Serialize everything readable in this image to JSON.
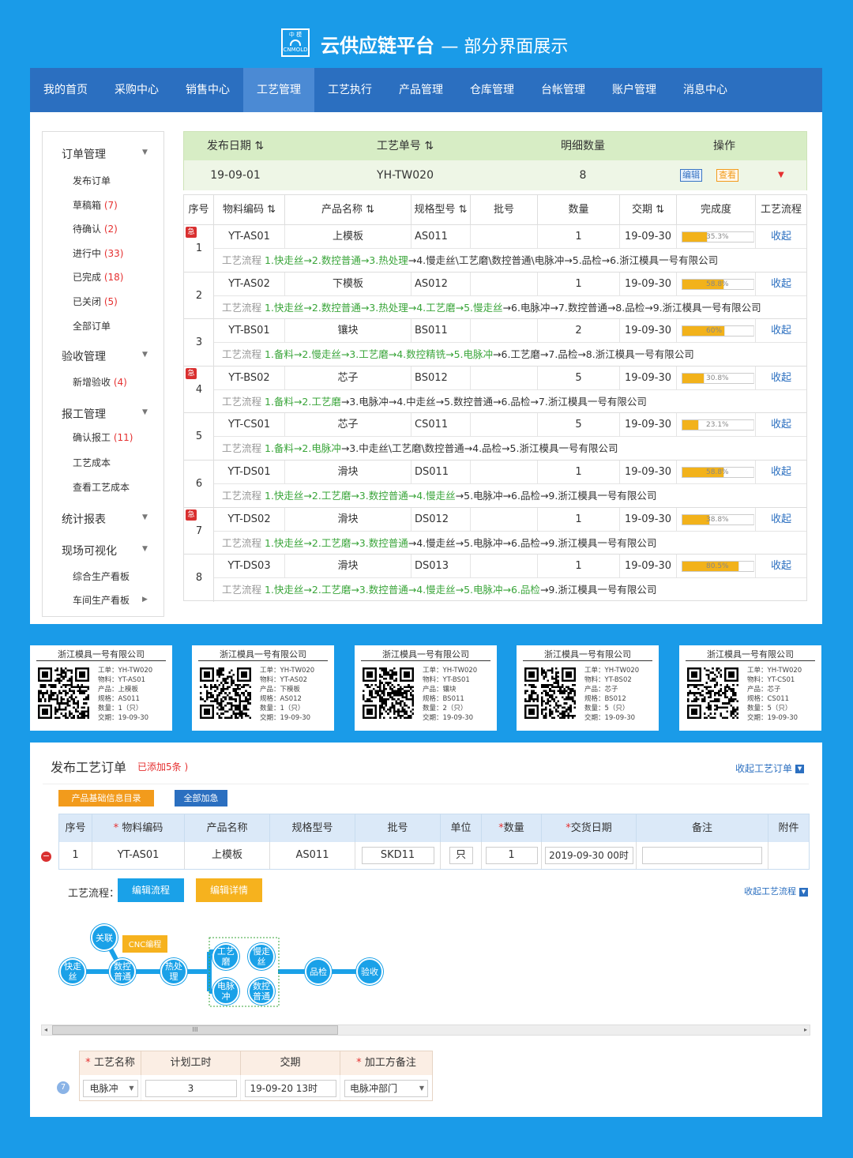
{
  "header": {
    "logo_text": "中模 CNMOLD",
    "title": "云供应链平台",
    "subtitle": "— 部分界面展示"
  },
  "nav": [
    "我的首页",
    "采购中心",
    "销售中心",
    "工艺管理",
    "工艺执行",
    "产品管理",
    "仓库管理",
    "台帐管理",
    "账户管理",
    "消息中心"
  ],
  "nav_active": "工艺管理",
  "sidebar": {
    "order_mgmt": "订单管理",
    "order_items": [
      {
        "label": "发布订单",
        "count": ""
      },
      {
        "label": "草稿箱",
        "count": "(7)"
      },
      {
        "label": "待确认",
        "count": "(2)"
      },
      {
        "label": "进行中",
        "count": "(33)"
      },
      {
        "label": "已完成",
        "count": "(18)"
      },
      {
        "label": "已关闭",
        "count": "(5)"
      },
      {
        "label": "全部订单",
        "count": ""
      }
    ],
    "accept_mgmt": "验收管理",
    "accept_items": [
      {
        "label": "新增验收",
        "count": "(4)"
      }
    ],
    "report_mgmt": "报工管理",
    "report_items": [
      {
        "label": "确认报工",
        "count": "(11)"
      },
      {
        "label": "工艺成本",
        "count": ""
      },
      {
        "label": "查看工艺成本",
        "count": ""
      }
    ],
    "stats": "统计报表",
    "visual": "现场可视化",
    "visual_items": [
      {
        "label": "综合生产看板",
        "count": ""
      },
      {
        "label": "车间生产看板",
        "count": ""
      }
    ]
  },
  "summary": {
    "headers": [
      "发布日期 ⇅",
      "工艺单号 ⇅",
      "明细数量",
      "操作"
    ],
    "date": "19-09-01",
    "order_no": "YH-TW020",
    "count": "8",
    "edit": "编辑",
    "view": "查看"
  },
  "detail": {
    "headers": [
      "序号",
      "物料编码 ⇅",
      "产品名称 ⇅",
      "规格型号 ⇅",
      "批号",
      "数量",
      "交期 ⇅",
      "完成度",
      "工艺流程"
    ],
    "flow_label": "工艺流程",
    "collapse": "收起",
    "urgent": "急",
    "rows": [
      {
        "n": "1",
        "urgent": true,
        "code": "YT-AS01",
        "name": "上模板",
        "spec": "AS011",
        "qty": "1",
        "due": "19-09-30",
        "pct": "35.3%",
        "done": "1.快走丝→2.数控普通→3.热处理",
        "rest": "→4.慢走丝\\工艺磨\\数控普通\\电脉冲→5.品检→6.浙江模具一号有限公司"
      },
      {
        "n": "2",
        "urgent": false,
        "code": "YT-AS02",
        "name": "下模板",
        "spec": "AS012",
        "qty": "1",
        "due": "19-09-30",
        "pct": "58.8%",
        "done": "1.快走丝→2.数控普通→3.热处理→4.工艺磨→5.慢走丝",
        "rest": "→6.电脉冲→7.数控普通→8.品检→9.浙江模具一号有限公司"
      },
      {
        "n": "3",
        "urgent": false,
        "code": "YT-BS01",
        "name": "镶块",
        "spec": "BS011",
        "qty": "2",
        "due": "19-09-30",
        "pct": "60%",
        "done": "1.备料→2.慢走丝→3.工艺磨→4.数控精铣→5.电脉冲",
        "rest": "→6.工艺磨→7.品检→8.浙江模具一号有限公司"
      },
      {
        "n": "4",
        "urgent": true,
        "code": "YT-BS02",
        "name": "芯子",
        "spec": "BS012",
        "qty": "5",
        "due": "19-09-30",
        "pct": "30.8%",
        "done": "1.备料→2.工艺磨",
        "rest": "→3.电脉冲→4.中走丝→5.数控普通→6.品检→7.浙江模具一号有限公司"
      },
      {
        "n": "5",
        "urgent": false,
        "code": "YT-CS01",
        "name": "芯子",
        "spec": "CS011",
        "qty": "5",
        "due": "19-09-30",
        "pct": "23.1%",
        "done": "1.备料→2.电脉冲",
        "rest": "→3.中走丝\\工艺磨\\数控普通→4.品检→5.浙江模具一号有限公司"
      },
      {
        "n": "6",
        "urgent": false,
        "code": "YT-DS01",
        "name": "滑块",
        "spec": "DS011",
        "qty": "1",
        "due": "19-09-30",
        "pct": "58.8%",
        "done": "1.快走丝→2.工艺磨→3.数控普通→4.慢走丝",
        "rest": "→5.电脉冲→6.品检→9.浙江模具一号有限公司"
      },
      {
        "n": "7",
        "urgent": true,
        "code": "YT-DS02",
        "name": "滑块",
        "spec": "DS012",
        "qty": "1",
        "due": "19-09-30",
        "pct": "38.8%",
        "done": "1.快走丝→2.工艺磨→3.数控普通",
        "rest": "→4.慢走丝→5.电脉冲→6.品检→9.浙江模具一号有限公司"
      },
      {
        "n": "8",
        "urgent": false,
        "code": "YT-DS03",
        "name": "滑块",
        "spec": "DS013",
        "qty": "1",
        "due": "19-09-30",
        "pct": "80.5%",
        "done": "1.快走丝→2.工艺磨→3.数控普通→4.慢走丝→5.电脉冲→6.品检",
        "rest": "→9.浙江模具一号有限公司"
      }
    ]
  },
  "qr_cards": [
    {
      "company": "浙江模具一号有限公司",
      "lines": [
        "工单：YH-TW020",
        "物料：YT-AS01",
        "产品：上模板",
        "规格：AS011",
        "数量：1（只）",
        "交期：19-09-30"
      ]
    },
    {
      "company": "浙江模具一号有限公司",
      "lines": [
        "工单：YH-TW020",
        "物料：YT-AS02",
        "产品：下模板",
        "规格：AS012",
        "数量：1（只）",
        "交期：19-09-30"
      ]
    },
    {
      "company": "浙江模具一号有限公司",
      "lines": [
        "工单：YH-TW020",
        "物料：YT-BS01",
        "产品：镶块",
        "规格：BS011",
        "数量：2（只）",
        "交期：19-09-30"
      ]
    },
    {
      "company": "浙江模具一号有限公司",
      "lines": [
        "工单：YH-TW020",
        "物料：YT-BS02",
        "产品：芯子",
        "规格：BS012",
        "数量：5（只）",
        "交期：19-09-30"
      ]
    },
    {
      "company": "浙江模具一号有限公司",
      "lines": [
        "工单：YH-TW020",
        "物料：YT-CS01",
        "产品：芯子",
        "规格：CS011",
        "数量：5（只）",
        "交期：19-09-30"
      ]
    }
  ],
  "publish": {
    "title": "发布工艺订单",
    "added": "已添加5条 )",
    "collapse_order": "收起工艺订单",
    "btn_catalog": "产品基础信息目录",
    "btn_urgent": "全部加急",
    "headers": [
      "序号",
      "物料编码",
      "产品名称",
      "规格型号",
      "批号",
      "单位",
      "数量",
      "交货日期",
      "备注",
      "附件"
    ],
    "row": {
      "n": "1",
      "code": "YT-AS01",
      "name": "上模板",
      "spec": "AS011",
      "batch": "SKD11",
      "unit": "只",
      "qty": "1",
      "date": "2019-09-30 00时",
      "note": "",
      "att": ""
    },
    "flow_label": "工艺流程：",
    "btn_edit_flow": "编辑流程",
    "btn_edit_detail": "编辑详情",
    "collapse_flow": "收起工艺流程",
    "nodes": {
      "a": "快走丝",
      "b": "数控普通",
      "c": "热处理",
      "d": "关联",
      "e": "CNC编程",
      "f": "工艺磨",
      "g": "慢走丝",
      "h": "电脉冲",
      "i": "数控普通",
      "j": "品检",
      "k": "验收"
    },
    "scroll_mark": "III",
    "proc_headers": [
      "工艺名称",
      "计划工时",
      "交期",
      "加工方备注"
    ],
    "proc_row": {
      "num": "7",
      "name": "电脉冲",
      "hours": "3",
      "due": "19-09-20 13时",
      "note": "电脉冲部门"
    }
  },
  "colors": {
    "bg": "#1a9be8",
    "nav": "#2b6fc0",
    "accent_orange": "#f29b1c",
    "green": "#3aa53a",
    "red": "#e53030"
  }
}
